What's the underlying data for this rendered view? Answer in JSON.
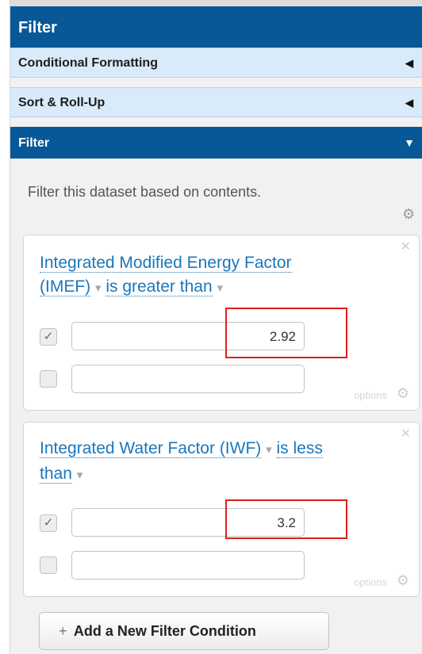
{
  "header": {
    "title": "Filter"
  },
  "accordion": [
    {
      "label": "Conditional Formatting",
      "arrow": "◀"
    },
    {
      "label": "Sort & Roll-Up",
      "arrow": "◀"
    },
    {
      "label": "Filter",
      "arrow": "▼"
    }
  ],
  "description": "Filter this dataset based on contents.",
  "icons": {
    "gear": "⚙",
    "close": "✕",
    "check": "✓"
  },
  "filters": [
    {
      "column": "Integrated Modified Energy Factor (IMEF)",
      "column_line1": "Integrated Modified Energy Factor",
      "column_line2": "(IMEF)",
      "operator": "is greater than",
      "dropdown": "▾",
      "values": [
        {
          "checked": true,
          "value": "2.92"
        },
        {
          "checked": false,
          "value": ""
        }
      ],
      "options_label": "options"
    },
    {
      "column": "Integrated Water Factor (IWF)",
      "operator_line1": "is less",
      "operator_line2": "than",
      "dropdown": "▾",
      "values": [
        {
          "checked": true,
          "value": "3.2"
        },
        {
          "checked": false,
          "value": ""
        }
      ],
      "options_label": "options"
    }
  ],
  "add_button": {
    "plus": "+",
    "label": "Add a New Filter Condition"
  },
  "colors": {
    "header": "#085897",
    "accordion": "#d9ebfa",
    "link": "#1a77bb",
    "highlight": "#e11c1c"
  }
}
